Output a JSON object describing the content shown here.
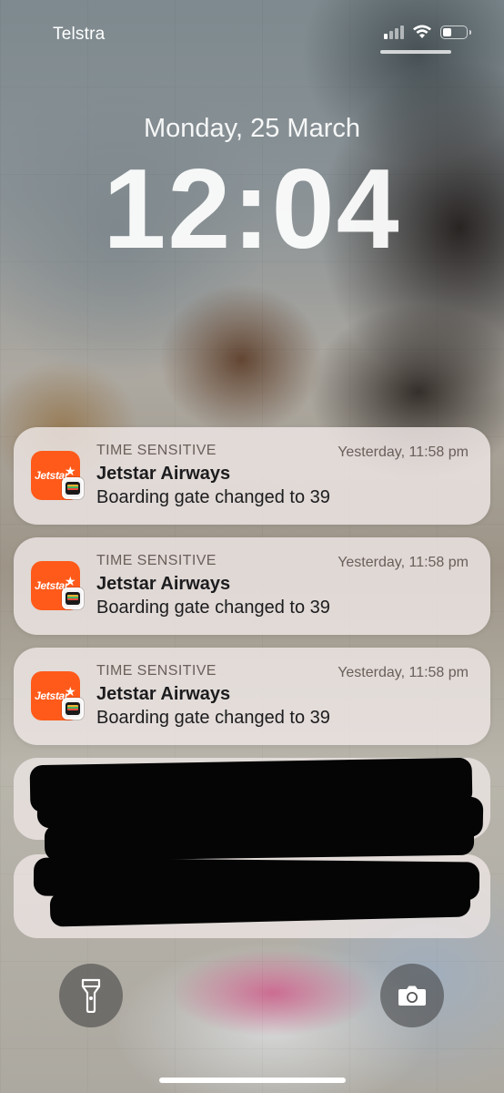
{
  "status_bar": {
    "carrier": "Telstra",
    "signal_bars_active": 1,
    "signal_bars_total": 4,
    "battery_level": 0.4
  },
  "lock_screen": {
    "date": "Monday, 25 March",
    "time": "12:04"
  },
  "notifications": [
    {
      "eyebrow": "TIME SENSITIVE",
      "timestamp": "Yesterday, 11:58 pm",
      "app_name": "Jetstar Airways",
      "message": "Boarding gate changed to 39",
      "icon_text": "Jetstar",
      "icon_color": "#ff5a1a"
    },
    {
      "eyebrow": "TIME SENSITIVE",
      "timestamp": "Yesterday, 11:58 pm",
      "app_name": "Jetstar Airways",
      "message": "Boarding gate changed to 39",
      "icon_text": "Jetstar",
      "icon_color": "#ff5a1a"
    },
    {
      "eyebrow": "TIME SENSITIVE",
      "timestamp": "Yesterday, 11:58 pm",
      "app_name": "Jetstar Airways",
      "message": "Boarding gate changed to 39",
      "icon_text": "Jetstar",
      "icon_color": "#ff5a1a"
    }
  ],
  "controls": {
    "flashlight_icon": "flashlight-icon",
    "camera_icon": "camera-icon"
  }
}
